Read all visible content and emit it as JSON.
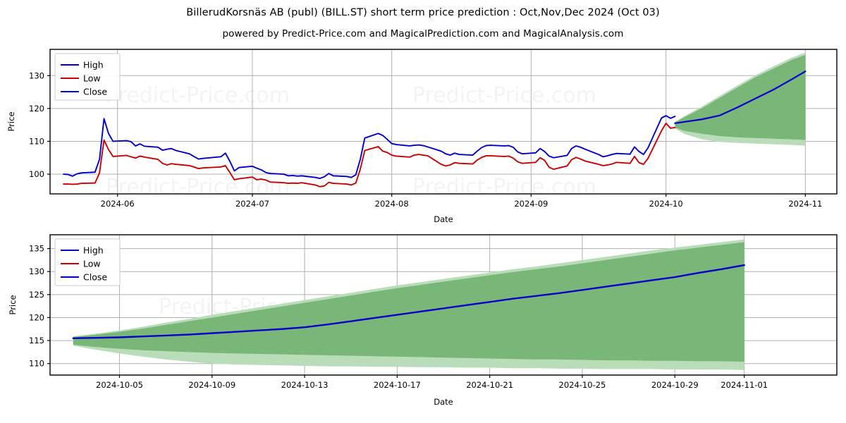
{
  "header": {
    "title": "BillerudKorsnäs AB (publ) (BILL.ST) short term price prediction : Oct,Nov,Dec 2024 (Oct 03)",
    "subtitle": "powered by Predict-Price.com and MagicalPrediction.com and MagicalAnalysis.com"
  },
  "watermark": {
    "text": "Predict-Price.com"
  },
  "colors": {
    "high": "#0000cc",
    "low": "#cc0000",
    "close": "#0000cc",
    "band_inner": "#79b779",
    "band_outer": "#b9dcb9",
    "grid": "#b0b0b0",
    "axis": "#000000",
    "background": "#ffffff"
  },
  "chart_data": [
    {
      "type": "line",
      "id": "overview",
      "title": "",
      "xlabel": "Date",
      "ylabel": "Price",
      "ylim": [
        94,
        138
      ],
      "yticks": [
        100,
        110,
        120,
        130
      ],
      "grid": true,
      "legend": [
        "High",
        "Low",
        "Close"
      ],
      "legend_position": "upper-left",
      "xlim": [
        "2024-05-17",
        "2024-11-08"
      ],
      "xticks": [
        "2024-06",
        "2024-07",
        "2024-08",
        "2024-09",
        "2024-10",
        "2024-11"
      ],
      "history_dates": [
        "2024-05-20",
        "2024-05-21",
        "2024-05-22",
        "2024-05-23",
        "2024-05-24",
        "2024-05-27",
        "2024-05-28",
        "2024-05-29",
        "2024-05-30",
        "2024-05-31",
        "2024-06-03",
        "2024-06-04",
        "2024-06-05",
        "2024-06-06",
        "2024-06-07",
        "2024-06-10",
        "2024-06-11",
        "2024-06-12",
        "2024-06-13",
        "2024-06-14",
        "2024-06-17",
        "2024-06-18",
        "2024-06-19",
        "2024-06-20",
        "2024-06-24",
        "2024-06-25",
        "2024-06-26",
        "2024-06-27",
        "2024-06-28",
        "2024-07-01",
        "2024-07-02",
        "2024-07-03",
        "2024-07-04",
        "2024-07-05",
        "2024-07-08",
        "2024-07-09",
        "2024-07-10",
        "2024-07-11",
        "2024-07-12",
        "2024-07-15",
        "2024-07-16",
        "2024-07-17",
        "2024-07-18",
        "2024-07-19",
        "2024-07-22",
        "2024-07-23",
        "2024-07-24",
        "2024-07-25",
        "2024-07-26",
        "2024-07-29",
        "2024-07-30",
        "2024-07-31",
        "2024-08-01",
        "2024-08-02",
        "2024-08-05",
        "2024-08-06",
        "2024-08-07",
        "2024-08-08",
        "2024-08-09",
        "2024-08-12",
        "2024-08-13",
        "2024-08-14",
        "2024-08-15",
        "2024-08-16",
        "2024-08-19",
        "2024-08-20",
        "2024-08-21",
        "2024-08-22",
        "2024-08-23",
        "2024-08-26",
        "2024-08-27",
        "2024-08-28",
        "2024-08-29",
        "2024-08-30",
        "2024-09-02",
        "2024-09-03",
        "2024-09-04",
        "2024-09-05",
        "2024-09-06",
        "2024-09-09",
        "2024-09-10",
        "2024-09-11",
        "2024-09-12",
        "2024-09-13",
        "2024-09-16",
        "2024-09-17",
        "2024-09-18",
        "2024-09-19",
        "2024-09-20",
        "2024-09-23",
        "2024-09-24",
        "2024-09-25",
        "2024-09-26",
        "2024-09-27",
        "2024-09-30",
        "2024-10-01",
        "2024-10-02",
        "2024-10-03"
      ],
      "high": [
        100.0,
        99.9,
        99.4,
        100.1,
        100.4,
        100.6,
        104.5,
        116.9,
        112.4,
        110.0,
        110.2,
        109.9,
        108.6,
        109.2,
        108.5,
        108.2,
        107.3,
        107.6,
        107.8,
        107.2,
        106.2,
        105.4,
        104.6,
        104.8,
        105.3,
        106.4,
        103.9,
        101.0,
        102.0,
        102.4,
        101.8,
        101.3,
        100.5,
        100.2,
        100.0,
        99.5,
        99.6,
        99.4,
        99.5,
        99.0,
        98.7,
        99.2,
        100.2,
        99.5,
        99.3,
        99.0,
        99.8,
        104.5,
        111.0,
        112.4,
        111.8,
        110.6,
        109.3,
        109.0,
        108.6,
        108.8,
        108.9,
        108.7,
        108.3,
        107.0,
        106.2,
        105.8,
        106.4,
        106.0,
        105.8,
        107.0,
        108.1,
        108.7,
        108.8,
        108.6,
        108.7,
        108.2,
        106.8,
        106.2,
        106.5,
        107.8,
        106.9,
        105.5,
        105.0,
        105.7,
        107.8,
        108.6,
        108.2,
        107.6,
        106.0,
        105.3,
        105.6,
        106.0,
        106.3,
        106.1,
        108.3,
        106.9,
        106.0,
        108.0,
        117.1,
        117.8,
        117.0,
        117.6
      ],
      "low": [
        97.0,
        97.0,
        96.9,
        97.0,
        97.2,
        97.3,
        100.4,
        110.4,
        107.5,
        105.4,
        105.7,
        105.3,
        104.9,
        105.5,
        105.2,
        104.5,
        103.3,
        102.8,
        103.2,
        103.0,
        102.6,
        102.2,
        101.7,
        101.9,
        102.2,
        102.6,
        100.5,
        98.3,
        98.6,
        99.1,
        98.3,
        98.5,
        98.2,
        97.6,
        97.4,
        97.2,
        97.3,
        97.2,
        97.4,
        96.7,
        96.2,
        96.4,
        97.5,
        97.2,
        97.0,
        96.7,
        97.3,
        101.5,
        107.2,
        108.4,
        107.0,
        106.6,
        105.8,
        105.5,
        105.2,
        105.8,
        106.0,
        105.8,
        105.6,
        103.0,
        102.5,
        102.8,
        103.5,
        103.3,
        103.1,
        104.3,
        105.1,
        105.6,
        105.6,
        105.4,
        105.5,
        104.9,
        103.8,
        103.3,
        103.6,
        105.0,
        104.2,
        102.1,
        101.5,
        102.5,
        104.4,
        105.1,
        104.6,
        104.0,
        103.0,
        102.6,
        102.8,
        103.1,
        103.6,
        103.3,
        105.4,
        103.5,
        103.0,
        104.8,
        113.2,
        115.5,
        114.0,
        114.2
      ],
      "forecast_dates": [
        "2024-10-03",
        "2024-10-05",
        "2024-10-09",
        "2024-10-13",
        "2024-10-17",
        "2024-10-21",
        "2024-10-25",
        "2024-10-29",
        "2024-11-01"
      ],
      "forecast_close": [
        115.5,
        115.9,
        116.7,
        117.9,
        120.4,
        123.1,
        125.8,
        128.9,
        131.3
      ],
      "forecast_band_inner_upper": [
        115.8,
        117.3,
        120.1,
        123.3,
        126.5,
        129.6,
        132.2,
        134.8,
        136.3
      ],
      "forecast_band_inner_lower": [
        114.2,
        113.2,
        112.3,
        111.6,
        111.2,
        111.0,
        110.8,
        110.6,
        110.4
      ],
      "forecast_band_outer_upper": [
        115.9,
        117.6,
        120.6,
        123.9,
        127.1,
        130.2,
        132.9,
        135.5,
        137.0
      ],
      "forecast_band_outer_lower": [
        113.9,
        112.3,
        110.6,
        109.8,
        109.5,
        109.3,
        109.1,
        108.9,
        108.7
      ]
    },
    {
      "type": "line",
      "id": "forecast-detail",
      "title": "",
      "xlabel": "Date",
      "ylabel": "Price",
      "ylim": [
        107.5,
        138
      ],
      "yticks": [
        110,
        115,
        120,
        125,
        130,
        135
      ],
      "grid": true,
      "legend": [
        "High",
        "Low",
        "Close"
      ],
      "legend_position": "upper-left",
      "xticks": [
        "2024-10-05",
        "2024-10-09",
        "2024-10-13",
        "2024-10-17",
        "2024-10-21",
        "2024-10-25",
        "2024-10-29",
        "2024-11-01"
      ],
      "x": [
        "2024-10-03",
        "2024-10-04",
        "2024-10-05",
        "2024-10-06",
        "2024-10-07",
        "2024-10-08",
        "2024-10-09",
        "2024-10-10",
        "2024-10-11",
        "2024-10-12",
        "2024-10-13",
        "2024-10-14",
        "2024-10-15",
        "2024-10-16",
        "2024-10-17",
        "2024-10-18",
        "2024-10-19",
        "2024-10-20",
        "2024-10-21",
        "2024-10-22",
        "2024-10-23",
        "2024-10-24",
        "2024-10-25",
        "2024-10-26",
        "2024-10-27",
        "2024-10-28",
        "2024-10-29",
        "2024-10-30",
        "2024-10-31",
        "2024-11-01"
      ],
      "close": [
        115.5,
        115.6,
        115.7,
        115.9,
        116.1,
        116.3,
        116.6,
        116.9,
        117.2,
        117.5,
        117.9,
        118.5,
        119.2,
        119.9,
        120.6,
        121.3,
        122.0,
        122.7,
        123.4,
        124.1,
        124.7,
        125.3,
        126.0,
        126.7,
        127.4,
        128.1,
        128.8,
        129.7,
        130.5,
        131.4
      ],
      "band_inner_upper": [
        115.8,
        116.3,
        116.9,
        117.6,
        118.4,
        119.2,
        120.0,
        120.8,
        121.6,
        122.4,
        123.2,
        124.0,
        124.8,
        125.6,
        126.4,
        127.1,
        127.8,
        128.5,
        129.2,
        129.9,
        130.5,
        131.1,
        131.8,
        132.5,
        133.2,
        133.9,
        134.6,
        135.2,
        135.8,
        136.4
      ],
      "band_inner_lower": [
        114.1,
        113.6,
        113.2,
        112.9,
        112.7,
        112.5,
        112.3,
        112.2,
        112.1,
        112.0,
        111.9,
        111.8,
        111.7,
        111.6,
        111.5,
        111.4,
        111.3,
        111.2,
        111.1,
        111.0,
        110.9,
        110.9,
        110.8,
        110.7,
        110.7,
        110.6,
        110.6,
        110.5,
        110.5,
        110.4
      ],
      "band_outer_upper": [
        115.9,
        116.5,
        117.2,
        118.0,
        118.9,
        119.7,
        120.6,
        121.4,
        122.2,
        123.0,
        123.8,
        124.6,
        125.4,
        126.2,
        127.0,
        127.7,
        128.4,
        129.1,
        129.8,
        130.5,
        131.1,
        131.8,
        132.5,
        133.2,
        133.9,
        134.6,
        135.2,
        135.8,
        136.4,
        137.0
      ],
      "band_outer_lower": [
        113.9,
        113.0,
        112.2,
        111.5,
        110.9,
        110.4,
        110.0,
        109.8,
        109.7,
        109.6,
        109.5,
        109.4,
        109.4,
        109.3,
        109.3,
        109.2,
        109.2,
        109.1,
        109.1,
        109.0,
        109.0,
        108.9,
        108.9,
        108.8,
        108.8,
        108.8,
        108.7,
        108.7,
        108.7,
        108.6
      ]
    }
  ]
}
